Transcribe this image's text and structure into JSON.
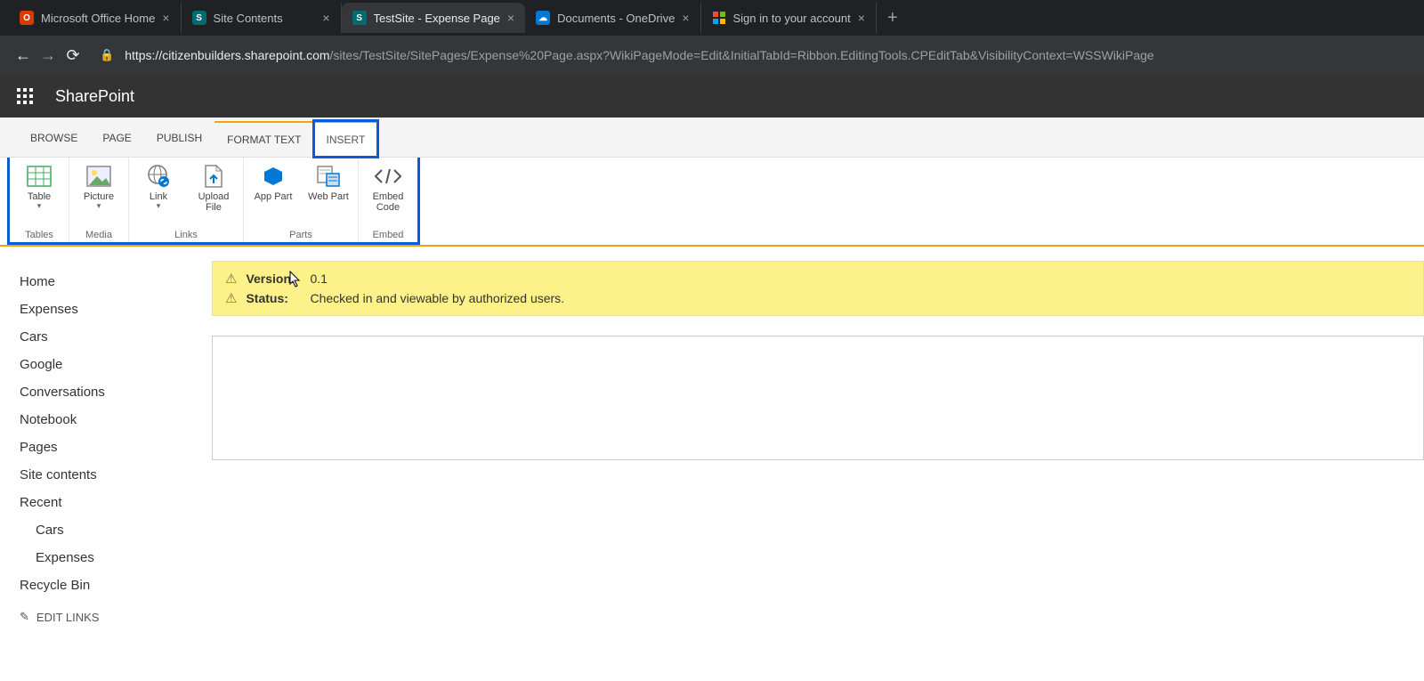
{
  "browser": {
    "tabs": [
      {
        "title": "Microsoft Office Home",
        "favicon_bg": "#d83b01",
        "favicon_text": "O",
        "active": false
      },
      {
        "title": "Site Contents",
        "favicon_bg": "#036c70",
        "favicon_text": "S",
        "active": false
      },
      {
        "title": "TestSite - Expense Page",
        "favicon_bg": "#036c70",
        "favicon_text": "S",
        "active": true
      },
      {
        "title": "Documents - OneDrive",
        "favicon_bg": "#0078d4",
        "favicon_text": "",
        "active": false
      },
      {
        "title": "Sign in to your account",
        "favicon_bg": "transparent",
        "favicon_text": "⊞",
        "active": false
      }
    ],
    "url_secure_host": "https://citizenbuilders.sharepoint.com",
    "url_path": "/sites/TestSite/SitePages/Expense%20Page.aspx?WikiPageMode=Edit&InitialTabId=Ribbon.EditingTools.CPEditTab&VisibilityContext=WSSWikiPage"
  },
  "sp": {
    "product": "SharePoint"
  },
  "ribbon": {
    "tabs": [
      "BROWSE",
      "PAGE",
      "PUBLISH",
      "FORMAT TEXT",
      "INSERT"
    ],
    "active_tab": "INSERT",
    "groups": [
      {
        "name": "Tables",
        "buttons": [
          {
            "label": "Table",
            "dropdown": true,
            "icon": "table"
          }
        ]
      },
      {
        "name": "Media",
        "buttons": [
          {
            "label": "Picture",
            "dropdown": true,
            "icon": "picture"
          }
        ]
      },
      {
        "name": "Links",
        "buttons": [
          {
            "label": "Link",
            "dropdown": true,
            "icon": "link"
          },
          {
            "label": "Upload File",
            "icon": "upload"
          }
        ]
      },
      {
        "name": "Parts",
        "buttons": [
          {
            "label": "App Part",
            "icon": "apppart"
          },
          {
            "label": "Web Part",
            "icon": "webpart"
          }
        ]
      },
      {
        "name": "Embed",
        "buttons": [
          {
            "label": "Embed Code",
            "icon": "embed"
          }
        ]
      }
    ]
  },
  "quicklaunch": {
    "items": [
      {
        "label": "Home"
      },
      {
        "label": "Expenses"
      },
      {
        "label": "Cars"
      },
      {
        "label": "Google"
      },
      {
        "label": "Conversations"
      },
      {
        "label": "Notebook"
      },
      {
        "label": "Pages"
      },
      {
        "label": "Site contents"
      },
      {
        "label": "Recent"
      },
      {
        "label": "Cars",
        "sub": true
      },
      {
        "label": "Expenses",
        "sub": true
      },
      {
        "label": "Recycle Bin"
      }
    ],
    "edit": "EDIT LINKS"
  },
  "status": {
    "version_label": "Version:",
    "version_value": "0.1",
    "status_label": "Status:",
    "status_value": "Checked in and viewable by authorized users."
  }
}
